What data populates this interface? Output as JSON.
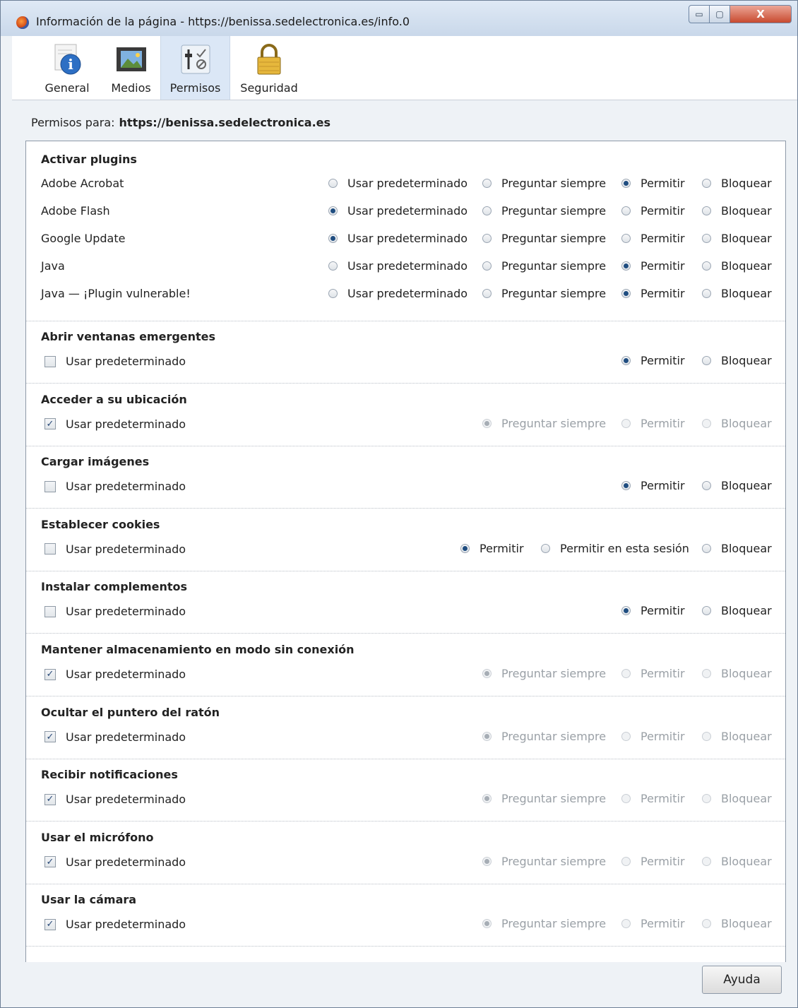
{
  "window": {
    "title": "Información de la página - https://benissa.sedelectronica.es/info.0",
    "controls": {
      "minimize": "▭",
      "maximize": "▢",
      "close": "X"
    }
  },
  "tabs": [
    {
      "label": "General",
      "icon": "info-icon"
    },
    {
      "label": "Medios",
      "icon": "media-icon"
    },
    {
      "label": "Permisos",
      "icon": "permissions-icon",
      "selected": true
    },
    {
      "label": "Seguridad",
      "icon": "lock-icon"
    }
  ],
  "permissions_for": {
    "label": "Permisos para:",
    "site": "https://benissa.sedelectronica.es"
  },
  "plugins": {
    "title": "Activar plugins",
    "options": [
      "Usar predeterminado",
      "Preguntar siempre",
      "Permitir",
      "Bloquear"
    ],
    "rows": [
      {
        "name": "Adobe Acrobat",
        "selected": 2
      },
      {
        "name": "Adobe Flash",
        "selected": 0
      },
      {
        "name": "Google Update",
        "selected": 0
      },
      {
        "name": "Java",
        "selected": 2
      },
      {
        "name": "Java — ¡Plugin vulnerable!",
        "selected": 2
      }
    ]
  },
  "sections": [
    {
      "title": "Abrir ventanas emergentes",
      "checkbox": "Usar predeterminado",
      "checked": false,
      "options": [
        "Permitir",
        "Bloquear"
      ],
      "selected": 0,
      "disabled": false
    },
    {
      "title": "Acceder a su ubicación",
      "checkbox": "Usar predeterminado",
      "checked": true,
      "options": [
        "Preguntar siempre",
        "Permitir",
        "Bloquear"
      ],
      "selected": 0,
      "disabled": true
    },
    {
      "title": "Cargar imágenes",
      "checkbox": "Usar predeterminado",
      "checked": false,
      "options": [
        "Permitir",
        "Bloquear"
      ],
      "selected": 0,
      "disabled": false
    },
    {
      "title": "Establecer cookies",
      "checkbox": "Usar predeterminado",
      "checked": false,
      "options": [
        "Permitir",
        "Permitir en esta sesión",
        "Bloquear"
      ],
      "selected": 0,
      "disabled": false
    },
    {
      "title": "Instalar complementos",
      "checkbox": "Usar predeterminado",
      "checked": false,
      "options": [
        "Permitir",
        "Bloquear"
      ],
      "selected": 0,
      "disabled": false
    },
    {
      "title": "Mantener almacenamiento en modo sin conexión",
      "checkbox": "Usar predeterminado",
      "checked": true,
      "options": [
        "Preguntar siempre",
        "Permitir",
        "Bloquear"
      ],
      "selected": 0,
      "disabled": true
    },
    {
      "title": "Ocultar el puntero del ratón",
      "checkbox": "Usar predeterminado",
      "checked": true,
      "options": [
        "Preguntar siempre",
        "Permitir",
        "Bloquear"
      ],
      "selected": 0,
      "disabled": true
    },
    {
      "title": "Recibir notificaciones",
      "checkbox": "Usar predeterminado",
      "checked": true,
      "options": [
        "Preguntar siempre",
        "Permitir",
        "Bloquear"
      ],
      "selected": 0,
      "disabled": true
    },
    {
      "title": "Usar el micrófono",
      "checkbox": "Usar predeterminado",
      "checked": true,
      "options": [
        "Preguntar siempre",
        "Permitir",
        "Bloquear"
      ],
      "selected": 0,
      "disabled": true
    },
    {
      "title": "Usar la cámara",
      "checkbox": "Usar predeterminado",
      "checked": true,
      "options": [
        "Preguntar siempre",
        "Permitir",
        "Bloquear"
      ],
      "selected": 0,
      "disabled": true
    }
  ],
  "help_button": "Ayuda"
}
